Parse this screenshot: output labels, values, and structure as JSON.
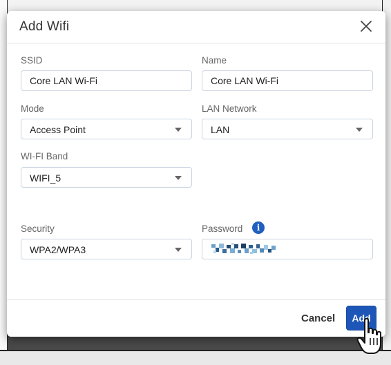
{
  "dialog": {
    "title": "Add Wifi",
    "close_icon": "close-icon"
  },
  "fields": {
    "ssid": {
      "label": "SSID",
      "value": "Core LAN Wi-Fi"
    },
    "name": {
      "label": "Name",
      "value": "Core LAN Wi-Fi"
    },
    "mode": {
      "label": "Mode",
      "value": "Access Point"
    },
    "lan_network": {
      "label": "LAN Network",
      "value": "LAN"
    },
    "wifi_band": {
      "label": "WI-FI Band",
      "value": "WIFI_5"
    },
    "security": {
      "label": "Security",
      "value": "WPA2/WPA3"
    },
    "password": {
      "label": "Password",
      "info_icon": "info-icon",
      "value_obscured": true
    }
  },
  "footer": {
    "cancel_label": "Cancel",
    "add_label": "Add"
  },
  "colors": {
    "primary": "#1e56b8",
    "info": "#1f5fbf",
    "input_border": "#c9d4e0"
  }
}
